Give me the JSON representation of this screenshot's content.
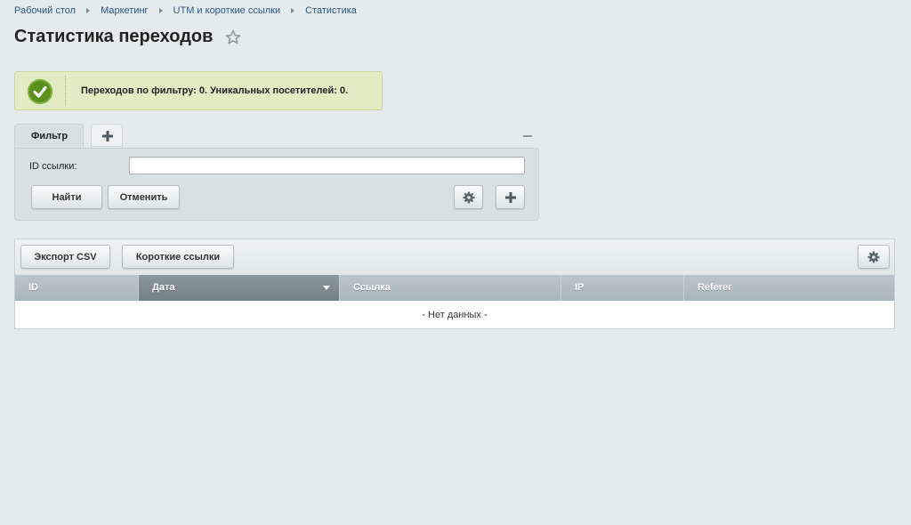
{
  "breadcrumb": [
    "Рабочий стол",
    "Маркетинг",
    "UTM и короткие ссылки",
    "Статистика"
  ],
  "page_title": "Статистика переходов",
  "message": "Переходов по фильтру: 0. Уникальных посетителей: 0.",
  "filter": {
    "tab_label": "Фильтр",
    "id_label": "ID ссылки:",
    "id_value": "",
    "find_label": "Найти",
    "cancel_label": "Отменить"
  },
  "toolbar": {
    "export_label": "Экспорт CSV",
    "short_links_label": "Короткие ссылки"
  },
  "table": {
    "columns": [
      "ID",
      "Дата",
      "Ссылка",
      "IP",
      "Referer"
    ],
    "sorted_column": "Дата",
    "empty_text": "- Нет данных -"
  },
  "icons": {
    "star": "star-icon",
    "check": "check-icon",
    "add": "plus-icon",
    "settings": "gear-icon",
    "collapse": "minus-icon"
  },
  "colors": {
    "link": "#2a5588",
    "success_bg": "#e2ebc4",
    "check_green": "#5a8f1d",
    "header_bg": "#a9b6bb"
  }
}
